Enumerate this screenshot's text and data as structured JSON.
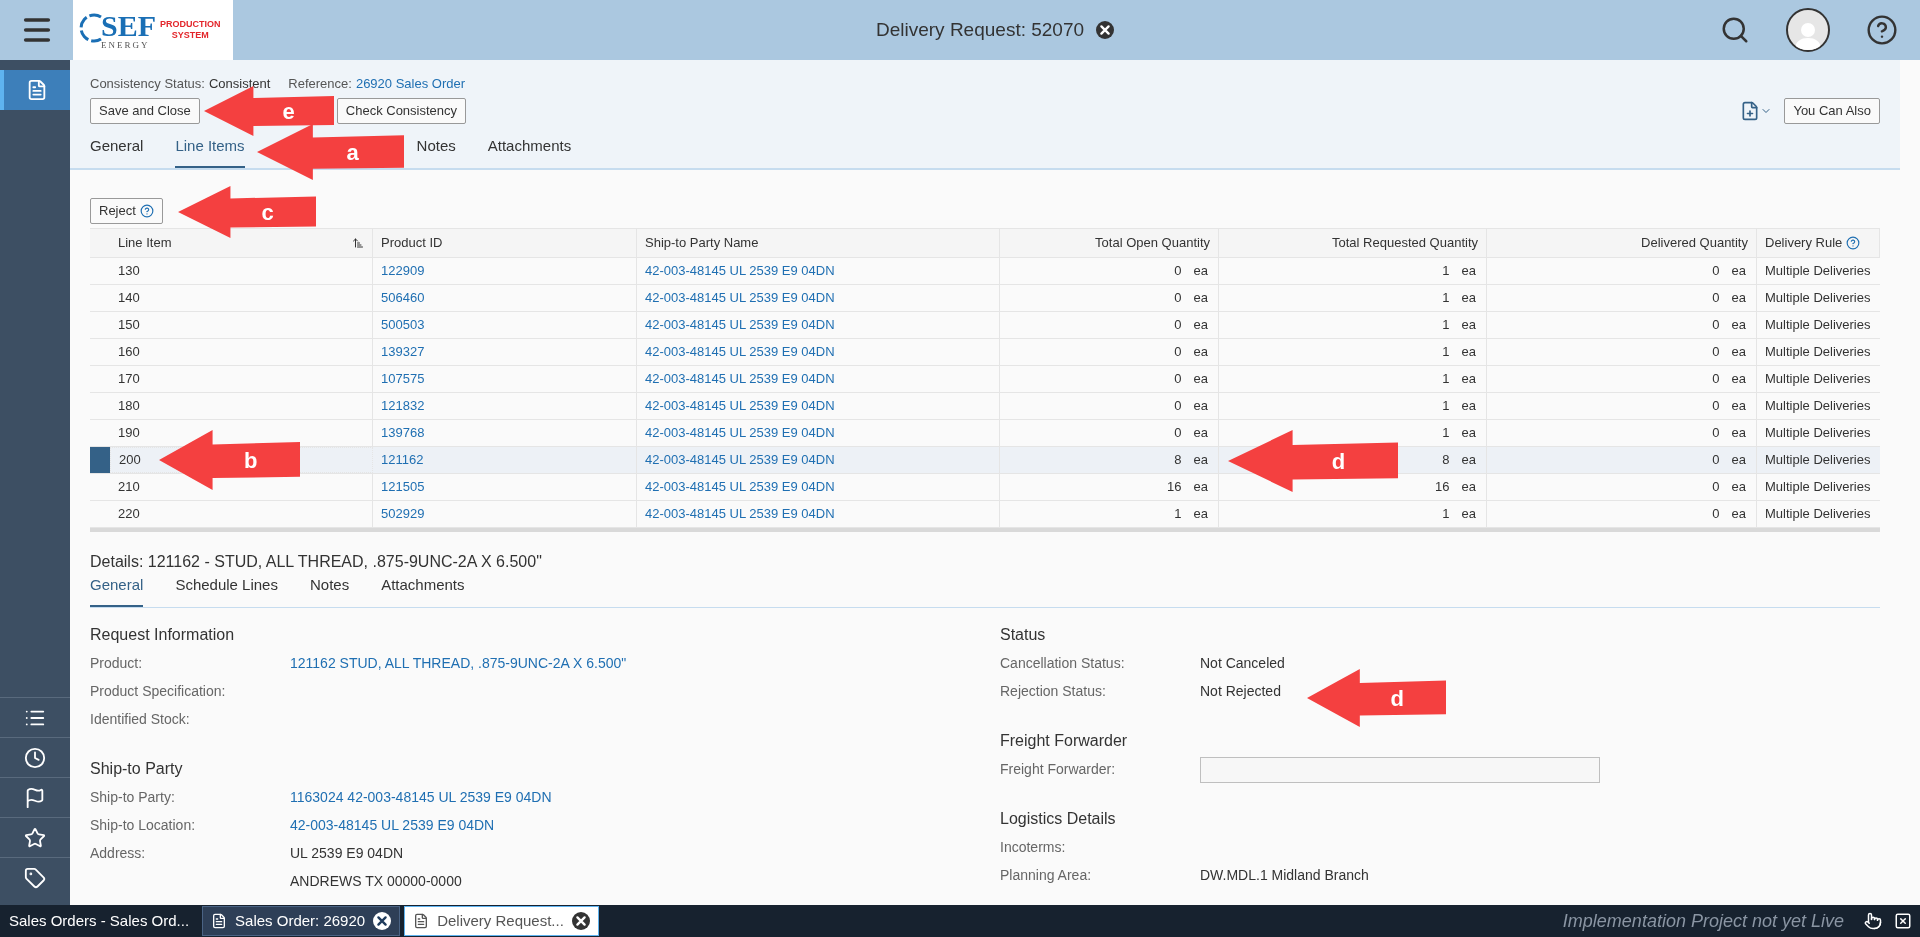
{
  "header": {
    "title": "Delivery Request: 52070",
    "logo": {
      "name": "SEF",
      "sub": "ENERGY",
      "tag_lines": [
        "PRODUCTION",
        "SYSTEM"
      ]
    }
  },
  "sidebar": {
    "items": [
      {
        "kind": "document",
        "selected": true
      },
      {
        "kind": "list",
        "selected": false
      },
      {
        "kind": "clock",
        "selected": false
      },
      {
        "kind": "flag",
        "selected": false
      },
      {
        "kind": "favorites",
        "selected": false
      },
      {
        "kind": "tag",
        "selected": false
      }
    ]
  },
  "object_header": {
    "consistency_label": "Consistency Status:",
    "consistency_value": "Consistent",
    "reference_label": "Reference:",
    "reference_value": "26920 Sales Order"
  },
  "actions": [
    "Save and Close",
    "Check Consistency"
  ],
  "you_can_also": "You Can Also",
  "tabs": [
    {
      "label": "General",
      "selected": false
    },
    {
      "label": "Line Items",
      "selected": true
    },
    {
      "label": "Notes",
      "selected": false
    },
    {
      "label": "Attachments",
      "selected": false
    }
  ],
  "table": {
    "reject_button": "Reject",
    "columns": [
      "Line Item",
      "Product ID",
      "Ship-to Party Name",
      "Total Open Quantity",
      "Total Requested Quantity",
      "Delivered Quantity",
      "Delivery Rule"
    ],
    "rows": [
      {
        "line_item": "130",
        "product_id": "122909",
        "ship_to": "42-003-48145 UL 2539 E9 04DN",
        "open": "0",
        "open_unit": "ea",
        "requested": "1",
        "requested_unit": "ea",
        "delivered": "0",
        "delivered_unit": "ea",
        "rule": "Multiple Deliveries",
        "selected": false
      },
      {
        "line_item": "140",
        "product_id": "506460",
        "ship_to": "42-003-48145 UL 2539 E9 04DN",
        "open": "0",
        "open_unit": "ea",
        "requested": "1",
        "requested_unit": "ea",
        "delivered": "0",
        "delivered_unit": "ea",
        "rule": "Multiple Deliveries",
        "selected": false
      },
      {
        "line_item": "150",
        "product_id": "500503",
        "ship_to": "42-003-48145 UL 2539 E9 04DN",
        "open": "0",
        "open_unit": "ea",
        "requested": "1",
        "requested_unit": "ea",
        "delivered": "0",
        "delivered_unit": "ea",
        "rule": "Multiple Deliveries",
        "selected": false
      },
      {
        "line_item": "160",
        "product_id": "139327",
        "ship_to": "42-003-48145 UL 2539 E9 04DN",
        "open": "0",
        "open_unit": "ea",
        "requested": "1",
        "requested_unit": "ea",
        "delivered": "0",
        "delivered_unit": "ea",
        "rule": "Multiple Deliveries",
        "selected": false
      },
      {
        "line_item": "170",
        "product_id": "107575",
        "ship_to": "42-003-48145 UL 2539 E9 04DN",
        "open": "0",
        "open_unit": "ea",
        "requested": "1",
        "requested_unit": "ea",
        "delivered": "0",
        "delivered_unit": "ea",
        "rule": "Multiple Deliveries",
        "selected": false
      },
      {
        "line_item": "180",
        "product_id": "121832",
        "ship_to": "42-003-48145 UL 2539 E9 04DN",
        "open": "0",
        "open_unit": "ea",
        "requested": "1",
        "requested_unit": "ea",
        "delivered": "0",
        "delivered_unit": "ea",
        "rule": "Multiple Deliveries",
        "selected": false
      },
      {
        "line_item": "190",
        "product_id": "139768",
        "ship_to": "42-003-48145 UL 2539 E9 04DN",
        "open": "0",
        "open_unit": "ea",
        "requested": "1",
        "requested_unit": "ea",
        "delivered": "0",
        "delivered_unit": "ea",
        "rule": "Multiple Deliveries",
        "selected": false
      },
      {
        "line_item": "200",
        "product_id": "121162",
        "ship_to": "42-003-48145 UL 2539 E9 04DN",
        "open": "8",
        "open_unit": "ea",
        "requested": "8",
        "requested_unit": "ea",
        "delivered": "0",
        "delivered_unit": "ea",
        "rule": "Multiple Deliveries",
        "selected": true
      },
      {
        "line_item": "210",
        "product_id": "121505",
        "ship_to": "42-003-48145 UL 2539 E9 04DN",
        "open": "16",
        "open_unit": "ea",
        "requested": "16",
        "requested_unit": "ea",
        "delivered": "0",
        "delivered_unit": "ea",
        "rule": "Multiple Deliveries",
        "selected": false
      },
      {
        "line_item": "220",
        "product_id": "502929",
        "ship_to": "42-003-48145 UL 2539 E9 04DN",
        "open": "1",
        "open_unit": "ea",
        "requested": "1",
        "requested_unit": "ea",
        "delivered": "0",
        "delivered_unit": "ea",
        "rule": "Multiple Deliveries",
        "selected": false
      }
    ]
  },
  "details": {
    "title": "Details: 121162 - STUD, ALL THREAD, .875-9UNC-2A X 6.500\"",
    "tabs": [
      {
        "label": "General",
        "selected": true
      },
      {
        "label": "Schedule Lines",
        "selected": false
      },
      {
        "label": "Notes",
        "selected": false
      },
      {
        "label": "Attachments",
        "selected": false
      }
    ],
    "left_sections": [
      {
        "title": "Request Information",
        "fields": [
          {
            "label": "Product:",
            "value": "121162 STUD, ALL THREAD, .875-9UNC-2A X 6.500\"",
            "kind": "link"
          },
          {
            "label": "Product Specification:",
            "kind": "text"
          },
          {
            "label": "Identified Stock:",
            "kind": "text"
          }
        ]
      },
      {
        "title": "Ship-to Party",
        "fields": [
          {
            "label": "Ship-to Party:",
            "value": "1163024 42-003-48145 UL 2539 E9 04DN",
            "kind": "link"
          },
          {
            "label": "Ship-to Location:",
            "value": "42-003-48145 UL 2539 E9 04DN",
            "kind": "link"
          },
          {
            "label": "Address:",
            "value": "UL 2539 E9 04DN",
            "kind": "text"
          },
          {
            "value": "ANDREWS TX  00000-0000",
            "kind": "text"
          }
        ]
      }
    ],
    "right_sections": [
      {
        "title": "Status",
        "fields": [
          {
            "label": "Cancellation Status:",
            "value": "Not Canceled",
            "kind": "text"
          },
          {
            "label": "Rejection Status:",
            "value": "Not Rejected",
            "kind": "text"
          }
        ]
      },
      {
        "title": "Freight Forwarder",
        "fields": [
          {
            "label": "Freight Forwarder:",
            "kind": "input"
          }
        ]
      },
      {
        "title": "Logistics Details",
        "fields": [
          {
            "label": "Incoterms:",
            "kind": "text"
          },
          {
            "label": "Planning Area:",
            "value": "DW.MDL.1 Midland Branch",
            "kind": "text"
          }
        ]
      }
    ]
  },
  "callouts": [
    {
      "label": "e"
    },
    {
      "label": "a"
    },
    {
      "label": "c"
    },
    {
      "label": "b"
    },
    {
      "label": "d"
    },
    {
      "label": "d"
    }
  ],
  "taskbar": {
    "tabs": [
      {
        "label": "Sales Orders - Sales Ord...",
        "kind": "list",
        "selected": false,
        "closable": false
      },
      {
        "label": "Sales Order: 26920",
        "kind": "document",
        "selected": false,
        "closable": true
      },
      {
        "label": "Delivery Request...",
        "kind": "document",
        "selected": true,
        "closable": true
      }
    ],
    "status": "Implementation Project not yet Live"
  }
}
